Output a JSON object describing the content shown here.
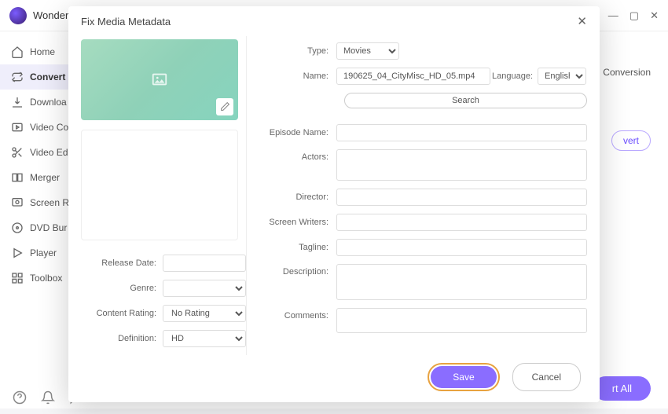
{
  "app": {
    "title": "Wonder"
  },
  "sidebar": {
    "items": [
      {
        "label": "Home"
      },
      {
        "label": "Convert"
      },
      {
        "label": "Downloa"
      },
      {
        "label": "Video Co"
      },
      {
        "label": "Video Ed"
      },
      {
        "label": "Merger"
      },
      {
        "label": "Screen R"
      },
      {
        "label": "DVD Bur"
      },
      {
        "label": "Player"
      },
      {
        "label": "Toolbox"
      }
    ]
  },
  "background": {
    "conversion": "Conversion",
    "vert": "vert",
    "start_all": "rt All"
  },
  "modal": {
    "title": "Fix Media Metadata",
    "left": {
      "release_date_label": "Release Date:",
      "release_date_value": "",
      "genre_label": "Genre:",
      "genre_value": "",
      "content_rating_label": "Content Rating:",
      "content_rating_value": "No Rating",
      "definition_label": "Definition:",
      "definition_value": "HD"
    },
    "right": {
      "type_label": "Type:",
      "type_value": "Movies",
      "name_label": "Name:",
      "name_value": "190625_04_CityMisc_HD_05.mp4",
      "language_label": "Language:",
      "language_value": "English",
      "search_label": "Search",
      "episode_name_label": "Episode Name:",
      "episode_name_value": "",
      "actors_label": "Actors:",
      "actors_value": "",
      "director_label": "Director:",
      "director_value": "",
      "screen_writers_label": "Screen Writers:",
      "screen_writers_value": "",
      "tagline_label": "Tagline:",
      "tagline_value": "",
      "description_label": "Description:",
      "description_value": "",
      "comments_label": "Comments:",
      "comments_value": ""
    },
    "buttons": {
      "save": "Save",
      "cancel": "Cancel"
    }
  }
}
